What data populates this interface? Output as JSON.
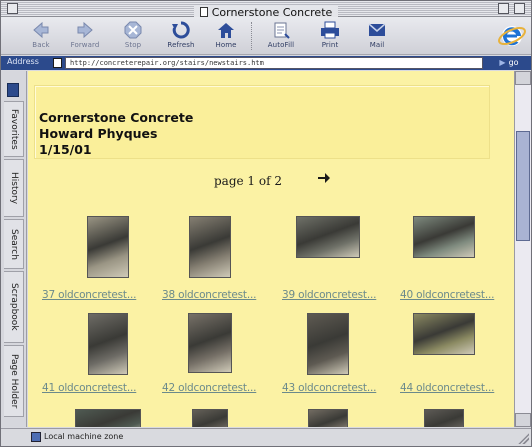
{
  "window": {
    "title": "Cornerstone Concrete"
  },
  "toolbar": {
    "back": "Back",
    "forward": "Forward",
    "stop": "Stop",
    "refresh": "Refresh",
    "home": "Home",
    "autofill": "AutoFill",
    "print": "Print",
    "mail": "Mail"
  },
  "address": {
    "label": "Address",
    "url": "http://concreterepair.org/stairs/newstairs.htm",
    "go": "go"
  },
  "sidebar": {
    "tabs": [
      "Favorites",
      "History",
      "Search",
      "Scrapbook",
      "Page Holder"
    ]
  },
  "page": {
    "header": {
      "line1": "Cornerstone Concrete",
      "line2": "Howard Phyques",
      "line3": "1/15/01"
    },
    "pager": "page 1 of 2",
    "thumbnails": [
      {
        "caption": "37 oldconcretest...",
        "tone": "#9a9584"
      },
      {
        "caption": "38 oldconcretest...",
        "tone": "#857f72"
      },
      {
        "caption": "39 oldconcretest...",
        "tone": "#6f7168"
      },
      {
        "caption": "40 oldconcretest...",
        "tone": "#7e8a7e"
      },
      {
        "caption": "41 oldconcretest...",
        "tone": "#6e6c66"
      },
      {
        "caption": "42 oldconcretest...",
        "tone": "#777168"
      },
      {
        "caption": "43 oldconcretest...",
        "tone": "#5e5a52"
      },
      {
        "caption": "44 oldconcretest...",
        "tone": "#8b8a62"
      },
      {
        "caption": "",
        "tone": "#4f5a52"
      },
      {
        "caption": "",
        "tone": "#646058"
      },
      {
        "caption": "",
        "tone": "#726c62"
      },
      {
        "caption": "",
        "tone": "#5d5a55"
      }
    ]
  },
  "status": {
    "text": "Local machine zone"
  },
  "colors": {
    "page_bg": "#fbf2a4",
    "link": "#6b8a8b",
    "address_bar": "#2c4a8c"
  }
}
